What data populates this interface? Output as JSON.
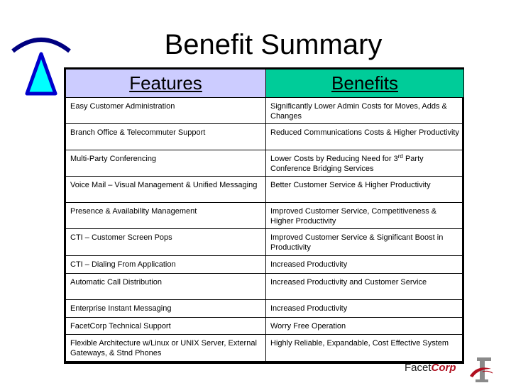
{
  "slide": {
    "title": "Benefit Summary"
  },
  "logos": {
    "left_icon": "tower-antenna-icon",
    "right_icon": "facetcorp-f-logo-icon",
    "brand_prefix": "Facet",
    "brand_suffix": "Corp"
  },
  "colors": {
    "features_header_bg": "#ccccff",
    "benefits_header_bg": "#00cc99",
    "antenna_arc": "#000080",
    "antenna_fill": "#00ffff",
    "antenna_stroke": "#0000cc",
    "brand_accent": "#b01020"
  },
  "table": {
    "headers": {
      "features": "Features",
      "benefits": "Benefits"
    },
    "rows": [
      {
        "feature": "Easy Customer Administration",
        "benefit": "Significantly Lower Admin Costs for Moves, Adds & Changes"
      },
      {
        "feature": "Branch Office & Telecommuter Support",
        "benefit": "Reduced Communications Costs & Higher Productivity"
      },
      {
        "feature": "Multi-Party Conferencing",
        "benefit_pre": "Lower Costs by Reducing Need for 3",
        "benefit_sup": "rd",
        "benefit_post": " Party Conference Bridging Services"
      },
      {
        "feature": "Voice Mail – Visual Management & Unified Messaging",
        "benefit": "Better Customer Service & Higher Productivity"
      },
      {
        "feature": "Presence & Availability Management",
        "benefit": "Improved Customer Service, Competitiveness & Higher Productivity"
      },
      {
        "feature": "CTI – Customer Screen Pops",
        "benefit": "Improved Customer Service & Significant Boost in Productivity"
      },
      {
        "feature": "CTI – Dialing From Application",
        "benefit": "Increased Productivity"
      },
      {
        "feature": "Automatic Call Distribution",
        "benefit": "Increased Productivity and Customer Service"
      },
      {
        "feature": "Enterprise Instant Messaging",
        "benefit": "Increased Productivity"
      },
      {
        "feature": "FacetCorp Technical Support",
        "benefit": "Worry Free Operation"
      },
      {
        "feature": "Flexible Architecture w/Linux or UNIX Server, External Gateways, & Stnd Phones",
        "benefit": "Highly Reliable, Expandable, Cost Effective System"
      }
    ]
  }
}
